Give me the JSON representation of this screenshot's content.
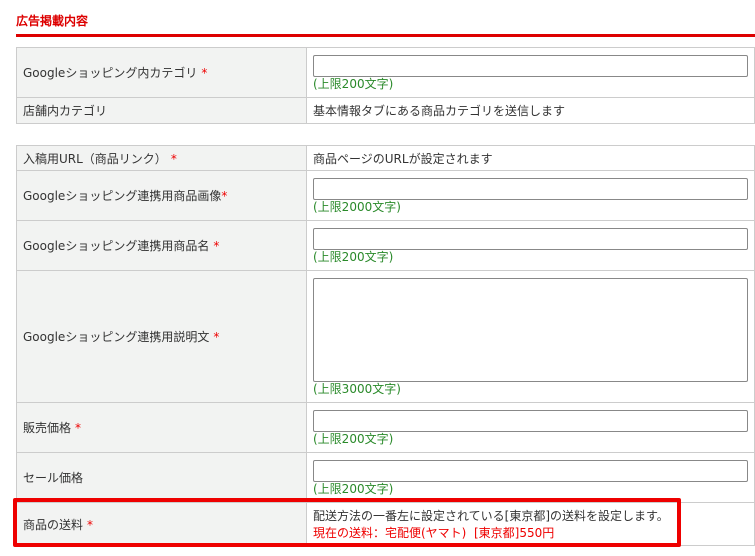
{
  "section_title": "広告掲載内容",
  "required_mark": "*",
  "table1": [
    {
      "label": "Googleショッピング内カテゴリ",
      "required": true,
      "type": "input",
      "value": "",
      "limit": "(上限200文字)"
    },
    {
      "label": "店舗内カテゴリ",
      "required": false,
      "type": "text",
      "text": "基本情報タブにある商品カテゴリを送信します"
    }
  ],
  "table2": [
    {
      "label": "入稿用URL（商品リンク）",
      "text": "商品ページのURLが設定されます"
    },
    {
      "label": "Googleショッピング連携用商品画像",
      "value": "",
      "limit": "(上限2000文字)"
    },
    {
      "label": "Googleショッピング連携用商品名",
      "value": "",
      "limit": "(上限200文字)"
    },
    {
      "label": "Googleショッピング連携用説明文",
      "value": "",
      "limit": "(上限3000文字)"
    },
    {
      "label": "販売価格",
      "value": "",
      "limit": "(上限200文字)"
    },
    {
      "label": "セール価格",
      "value": "",
      "limit": "(上限200文字)"
    },
    {
      "label": "商品の送料",
      "text": "配送方法の一番左に設定されている[東京都]の送料を設定します。",
      "current": "現在の送料：宅配便(ヤマト)  [東京都]550円"
    }
  ]
}
